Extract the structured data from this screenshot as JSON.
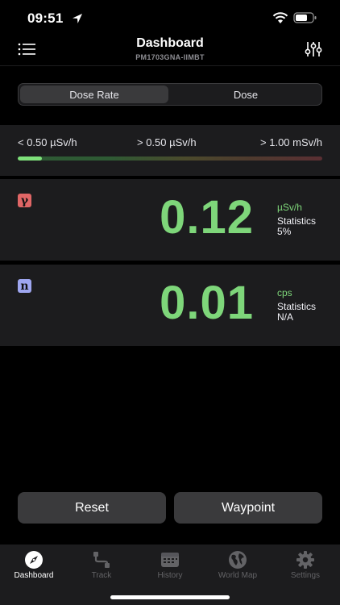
{
  "status_bar": {
    "time": "09:51",
    "icons": [
      "location-arrow-icon",
      "wifi-icon",
      "battery-icon"
    ]
  },
  "header": {
    "title": "Dashboard",
    "subtitle": "PM1703GNA-IIMBT",
    "left_icon": "menu-icon",
    "right_icon": "sliders-icon"
  },
  "segmented": {
    "options": [
      "Dose Rate",
      "Dose"
    ],
    "selected": "Dose Rate"
  },
  "range": {
    "labels": [
      "< 0.50 µSv/h",
      "> 0.50 µSv/h",
      "> 1.00 mSv/h"
    ],
    "level_fraction": 0.08,
    "colors": {
      "fill": "#7ee07a",
      "low": "#2f5a35",
      "mid": "#4e3b2e",
      "high": "#5a2f33"
    }
  },
  "gamma": {
    "badge": "γ",
    "badge_color": "#e06666",
    "value": "0.12",
    "unit": "µSv/h",
    "stat_label": "Statistics",
    "stat_value": "5%"
  },
  "neutron": {
    "badge": "n",
    "badge_color": "#9ea6f0",
    "value": "0.01",
    "unit": "cps",
    "stat_label": "Statistics",
    "stat_value": "N/A"
  },
  "actions": {
    "reset_label": "Reset",
    "waypoint_label": "Waypoint"
  },
  "tabs": [
    {
      "label": "Dashboard",
      "icon": "compass-icon",
      "active": true
    },
    {
      "label": "Track",
      "icon": "track-icon",
      "active": false
    },
    {
      "label": "History",
      "icon": "calendar-icon",
      "active": false
    },
    {
      "label": "World Map",
      "icon": "globe-icon",
      "active": false
    },
    {
      "label": "Settings",
      "icon": "gear-icon",
      "active": false
    }
  ],
  "accent_color": "#7ed67a"
}
